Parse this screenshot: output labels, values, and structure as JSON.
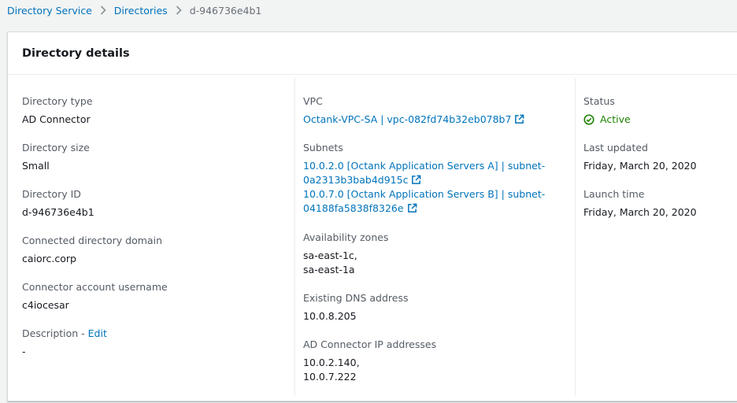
{
  "breadcrumb": {
    "items": [
      "Directory Service",
      "Directories"
    ],
    "current": "d-946736e4b1"
  },
  "panel": {
    "title": "Directory details"
  },
  "column1": {
    "directory_type": {
      "label": "Directory type",
      "value": "AD Connector"
    },
    "directory_size": {
      "label": "Directory size",
      "value": "Small"
    },
    "directory_id": {
      "label": "Directory ID",
      "value": "d-946736e4b1"
    },
    "connected_domain": {
      "label": "Connected directory domain",
      "value": "caiorc.corp"
    },
    "connector_username": {
      "label": "Connector account username",
      "value": "c4iocesar"
    },
    "description": {
      "label": "Description - ",
      "edit_label": "Edit",
      "value": "-"
    }
  },
  "column2": {
    "vpc": {
      "label": "VPC",
      "value": "Octank-VPC-SA | vpc-082fd74b32eb078b7"
    },
    "subnets": {
      "label": "Subnets",
      "items": [
        {
          "line1": "10.0.2.0 [Octank Application Servers A] | subnet-",
          "line2": "0a2313b3bab4d915c"
        },
        {
          "line1": "10.0.7.0 [Octank Application Servers B] | subnet-",
          "line2": "04188fa5838f8326e"
        }
      ]
    },
    "availability_zones": {
      "label": "Availability zones",
      "values": [
        "sa-east-1c,",
        "sa-east-1a"
      ]
    },
    "dns_address": {
      "label": "Existing DNS address",
      "value": "10.0.8.205"
    },
    "ip_addresses": {
      "label": "AD Connector IP addresses",
      "values": [
        "10.0.2.140,",
        "10.0.7.222"
      ]
    }
  },
  "column3": {
    "status": {
      "label": "Status",
      "value": "Active",
      "color": "#1d8102"
    },
    "last_updated": {
      "label": "Last updated",
      "value": "Friday, March 20, 2020"
    },
    "launch_time": {
      "label": "Launch time",
      "value": "Friday, March 20, 2020"
    }
  },
  "colors": {
    "link": "#0073bb",
    "label": "#545b64",
    "text": "#16191f",
    "success": "#1d8102"
  }
}
